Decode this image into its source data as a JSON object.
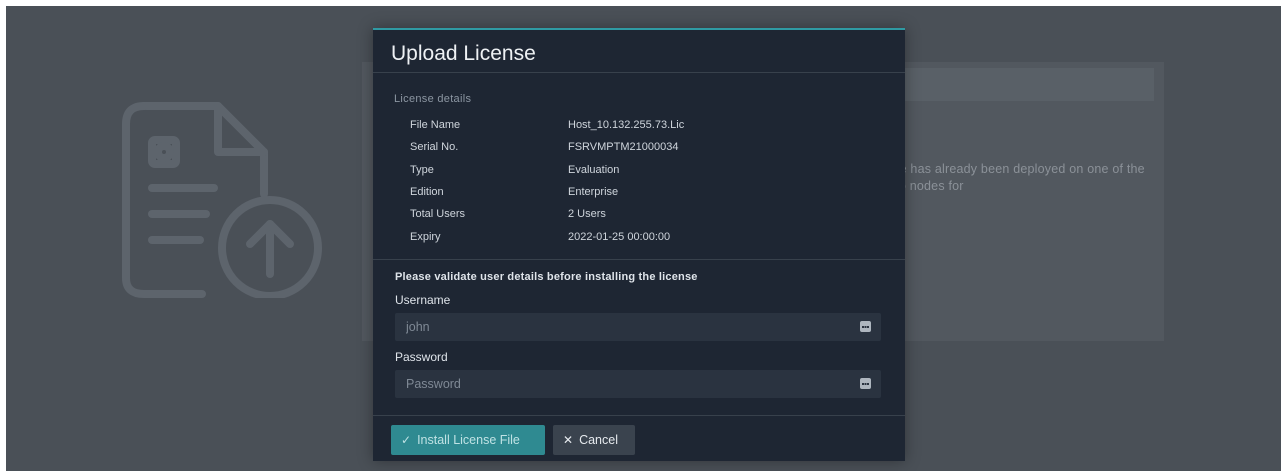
{
  "background": {
    "text_fragment": "nse has already been deployed on one of the two nodes for"
  },
  "modal": {
    "title": "Upload License",
    "license_details": {
      "caption": "License details",
      "rows": [
        {
          "label": "File Name",
          "value": "Host_10.132.255.73.Lic"
        },
        {
          "label": "Serial No.",
          "value": "FSRVMPTM21000034"
        },
        {
          "label": "Type",
          "value": "Evaluation"
        },
        {
          "label": "Edition",
          "value": "Enterprise"
        },
        {
          "label": "Total Users",
          "value": "2 Users"
        },
        {
          "label": "Expiry",
          "value": "2022-01-25 00:00:00"
        }
      ]
    },
    "validation": {
      "message": "Please validate user details before installing the license",
      "username": {
        "label": "Username",
        "value": "john",
        "placeholder": "Username"
      },
      "password": {
        "label": "Password",
        "value": "",
        "placeholder": "Password"
      }
    },
    "actions": {
      "install_label": "Install License File",
      "cancel_label": "Cancel"
    }
  },
  "colors": {
    "accent": "#2f8a91",
    "modal_bg": "#1e2633",
    "overlay": "#4a5057"
  },
  "icons": [
    "document-upload-icon",
    "key-icon",
    "checkmark-icon",
    "close-icon"
  ]
}
